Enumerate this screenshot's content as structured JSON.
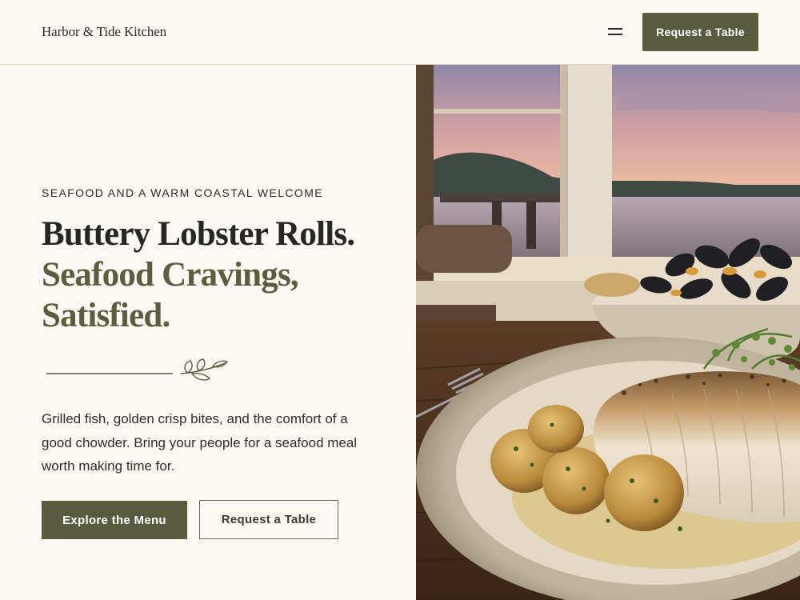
{
  "header": {
    "brand": "Harbor & Tide Kitchen",
    "menu_icon": "hamburger-menu-icon",
    "cta_label": "Request a Table"
  },
  "hero": {
    "eyebrow": "SEAFOOD AND A WARM COASTAL WELCOME",
    "headline_line1": "Buttery Lobster Rolls.",
    "headline_line2": "Seafood Cravings, Satisfied.",
    "divider_icon": "leaf-sprig-icon",
    "body": "Grilled fish, golden crisp bites, and the comfort of a good chowder. Bring your people for a seafood meal worth making time for.",
    "primary_cta": "Explore the Menu",
    "secondary_cta": "Request a Table"
  },
  "colors": {
    "background": "#fbf8f3",
    "accent_olive": "#585b3d",
    "headline_dark": "#262622",
    "headline_olive": "#5e5c3f"
  }
}
